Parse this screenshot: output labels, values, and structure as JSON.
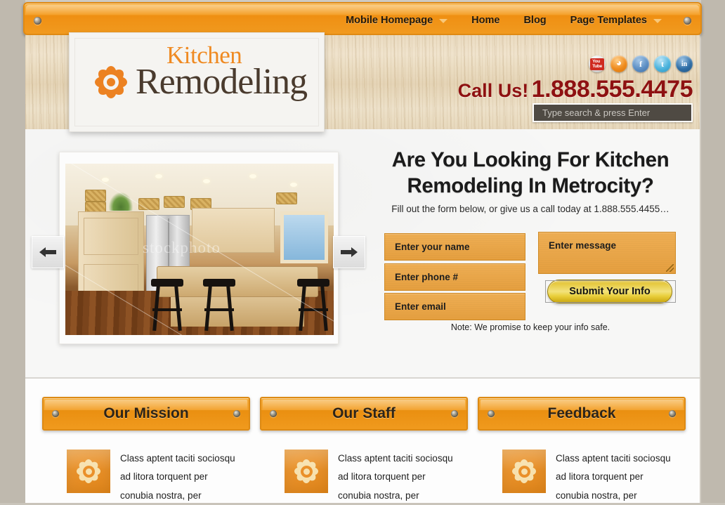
{
  "nav": {
    "items": [
      {
        "label": "Mobile Homepage",
        "has_caret": true
      },
      {
        "label": "Home",
        "has_caret": false
      },
      {
        "label": "Blog",
        "has_caret": false
      },
      {
        "label": "Page Templates",
        "has_caret": true
      }
    ]
  },
  "logo": {
    "line1": "Kitchen",
    "line2": "Remodeling",
    "icon": "flower-icon"
  },
  "social": [
    {
      "name": "youtube-icon",
      "label": "You Tube"
    },
    {
      "name": "rss-icon",
      "label": "◔"
    },
    {
      "name": "facebook-icon",
      "label": "f"
    },
    {
      "name": "twitter-icon",
      "label": "t"
    },
    {
      "name": "linkedin-icon",
      "label": "in"
    }
  ],
  "header": {
    "call_label": "Call Us!",
    "phone": "1.888.555.4475",
    "search_placeholder": "Type search & press Enter",
    "search_value": ""
  },
  "hero": {
    "headline_line1": "Are You Looking For Kitchen",
    "headline_line2": "Remodeling In Metrocity?",
    "subheading": "Fill out the form below, or give us a call today at 1.888.555.4455…",
    "prev_label": "←",
    "next_label": "→",
    "slide_watermark": "stockphoto"
  },
  "form": {
    "name_placeholder": "Enter your name",
    "phone_placeholder": "Enter phone #",
    "email_placeholder": "Enter email",
    "message_placeholder": "Enter message",
    "submit_label": "Submit Your Info",
    "note": "Note: We promise to keep your info safe."
  },
  "panels": [
    {
      "title": "Our Mission",
      "body": "Class aptent taciti sociosqu\nad litora torquent per\nconubia nostra, per",
      "icon": "flower-icon"
    },
    {
      "title": "Our Staff",
      "body": "Class aptent taciti sociosqu\nad litora torquent per\nconubia nostra, per",
      "icon": "flower-icon"
    },
    {
      "title": "Feedback",
      "body": "Class aptent taciti sociosqu\nad litora torquent per\nconubia nostra, per",
      "icon": "flower-icon"
    }
  ],
  "colors": {
    "nav_orange": "#f2a02a",
    "accent_orange": "#ec8222",
    "phone_red": "#8e1111",
    "field_orange": "#e8a446",
    "submit_gold": "#e6c83e",
    "heading_dark": "#1b1b1b",
    "wood_bg": "#e4d2b2"
  }
}
